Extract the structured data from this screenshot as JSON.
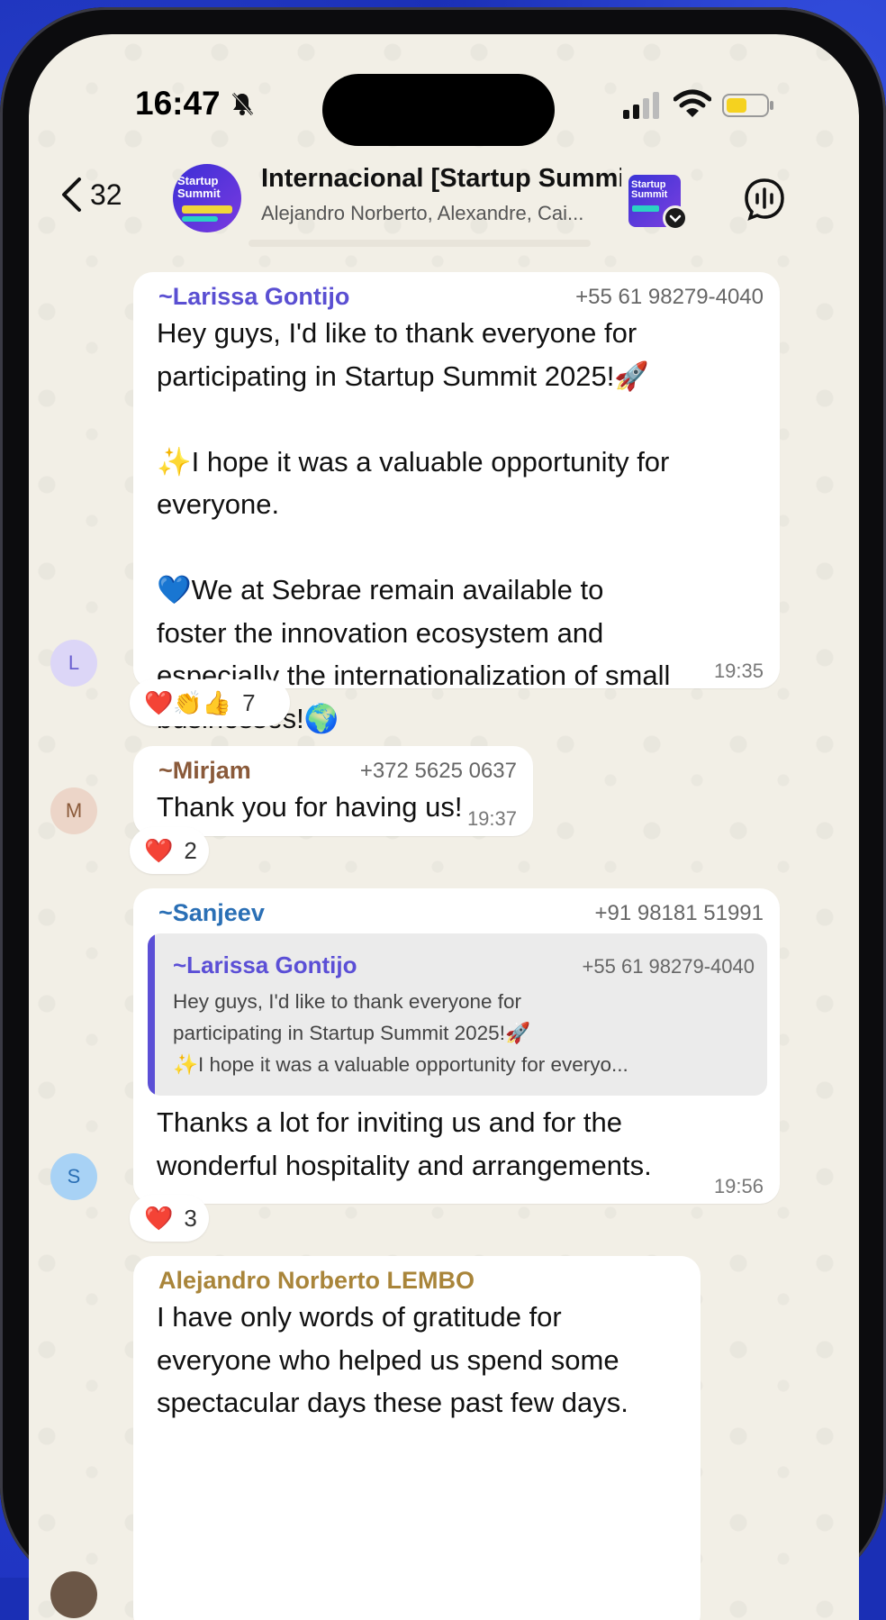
{
  "status_bar": {
    "time": "16:47"
  },
  "header": {
    "back_count": "32",
    "group_title": "Internacional [Startup Summi...",
    "group_members": "Alejandro Norberto, Alexandre, Cai...",
    "avatar_label": "Startup\nSummit"
  },
  "messages": [
    {
      "sender": "~Larissa Gontijo",
      "sender_color": "#5a4fd2",
      "phone": "+55 61 98279-4040",
      "text": "Hey guys, I'd like to thank everyone for\nparticipating in Startup Summit 2025!🚀\n\n✨I hope it was a valuable opportunity for\neveryone.\n\n💙We at Sebrae remain available to\nfoster the innovation ecosystem and\nespecially the internationalization of small\nbusinesses!🌍",
      "time": "19:35",
      "avatar_initial": "L",
      "avatar_color": "#dcd6f7",
      "avatar_text_color": "#6a5fd0",
      "reactions": "❤️👏👍",
      "reaction_count": "7"
    },
    {
      "sender": "~Mirjam",
      "sender_color": "#8a5a3a",
      "phone": "+372 5625 0637",
      "text": "Thank you for having us!",
      "time": "19:37",
      "avatar_initial": "M",
      "avatar_color": "#ecd5c8",
      "avatar_text_color": "#8a5a3a",
      "reactions": "❤️",
      "reaction_count": "2"
    },
    {
      "sender": "~Sanjeev",
      "sender_color": "#2a6fb5",
      "phone": "+91 98181 51991",
      "quote": {
        "sender": "~Larissa Gontijo",
        "phone": "+55 61 98279-4040",
        "text": "Hey guys, I'd like to thank everyone for\nparticipating in Startup Summit 2025!🚀\n✨I hope it was a valuable opportunity for everyo..."
      },
      "text": "Thanks a lot for inviting us and for the\nwonderful hospitality and arrangements.",
      "time": "19:56",
      "avatar_initial": "S",
      "avatar_color": "#a8d2f5",
      "avatar_text_color": "#2a6fb5",
      "reactions": "❤️",
      "reaction_count": "3"
    },
    {
      "sender": "Alejandro Norberto LEMBO",
      "sender_color": "#a9853a",
      "text": "I have only words of gratitude for\neveryone who helped us spend some\nspectacular days these past few days."
    }
  ]
}
